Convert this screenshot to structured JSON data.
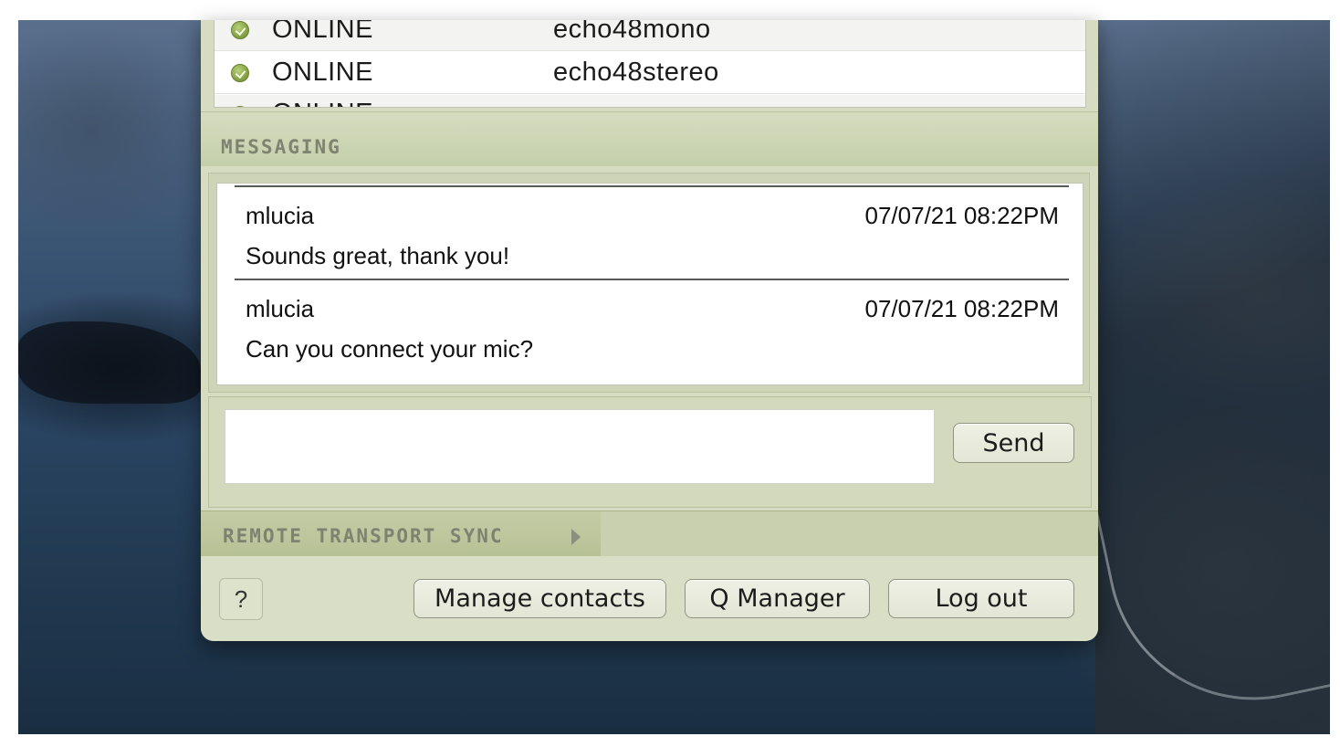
{
  "contacts": [
    {
      "status": "ONLINE",
      "name": "echo48mono"
    },
    {
      "status": "ONLINE",
      "name": "echo48stereo"
    },
    {
      "status": "ONLINE",
      "name": ""
    }
  ],
  "messaging": {
    "title": "MESSAGING",
    "messages": [
      {
        "sender": "mlucia",
        "time": "07/07/21 08:22PM",
        "text": "Sounds great, thank you!"
      },
      {
        "sender": "mlucia",
        "time": "07/07/21 08:22PM",
        "text": "Can you connect your mic?"
      }
    ],
    "input_value": "",
    "send_label": "Send"
  },
  "transport": {
    "label": "REMOTE TRANSPORT SYNC"
  },
  "footer": {
    "help_label": "?",
    "manage_contacts_label": "Manage contacts",
    "q_manager_label": "Q Manager",
    "logout_label": "Log out"
  },
  "colors": {
    "accent_green": "#8fac4a",
    "panel": "#d6dcc2"
  }
}
